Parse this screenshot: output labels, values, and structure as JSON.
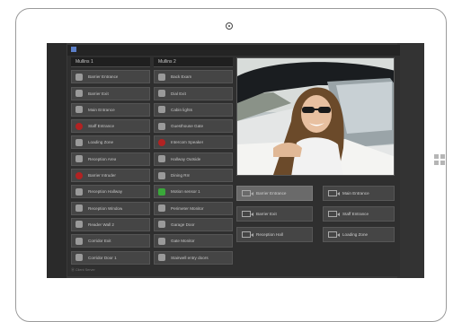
{
  "column_1": {
    "header": "Mullins 1",
    "items": [
      {
        "label": "Barrier Entrance",
        "status": "normal"
      },
      {
        "label": "Barrier Exit",
        "status": "normal"
      },
      {
        "label": "Main Entrance",
        "status": "normal"
      },
      {
        "label": "Staff Entrance",
        "status": "alarm"
      },
      {
        "label": "Loading Zone",
        "status": "normal"
      },
      {
        "label": "Reception Area",
        "status": "normal"
      },
      {
        "label": "Barrier Intruder",
        "status": "alarm"
      },
      {
        "label": "Reception Hallway",
        "status": "normal"
      },
      {
        "label": "Reception Window",
        "status": "normal"
      },
      {
        "label": "Reader Wall 2",
        "status": "normal"
      },
      {
        "label": "Corridor Exit",
        "status": "normal"
      },
      {
        "label": "Corridor Door 1",
        "status": "normal"
      }
    ],
    "footer": "Ⓜ Client Server"
  },
  "column_2": {
    "header": "Mullins 2",
    "items": [
      {
        "label": "Back Exam",
        "status": "normal"
      },
      {
        "label": "Dial Exit",
        "status": "normal"
      },
      {
        "label": "Cabin lights",
        "status": "normal"
      },
      {
        "label": "Guesthouse Gate",
        "status": "normal"
      },
      {
        "label": "Intercom Speaker",
        "status": "alarm"
      },
      {
        "label": "Hallway Outside",
        "status": "normal"
      },
      {
        "label": "Dining Rm",
        "status": "normal"
      },
      {
        "label": "Motion sensor 1",
        "status": "ok"
      },
      {
        "label": "Perimeter Monitor",
        "status": "normal"
      },
      {
        "label": "Garage Door",
        "status": "normal"
      },
      {
        "label": "Gate Monitor",
        "status": "normal"
      },
      {
        "label": "Stairwell entry doors",
        "status": "normal"
      }
    ]
  },
  "controls": [
    {
      "label": "Barrier Entrance",
      "active": true
    },
    {
      "label": "Main Entrance",
      "active": false
    },
    {
      "label": "Barrier Exit",
      "active": false
    },
    {
      "label": "Staff Entrance",
      "active": false
    },
    {
      "label": "Reception Hall",
      "active": false
    },
    {
      "label": "Loading Zone",
      "active": false
    }
  ]
}
